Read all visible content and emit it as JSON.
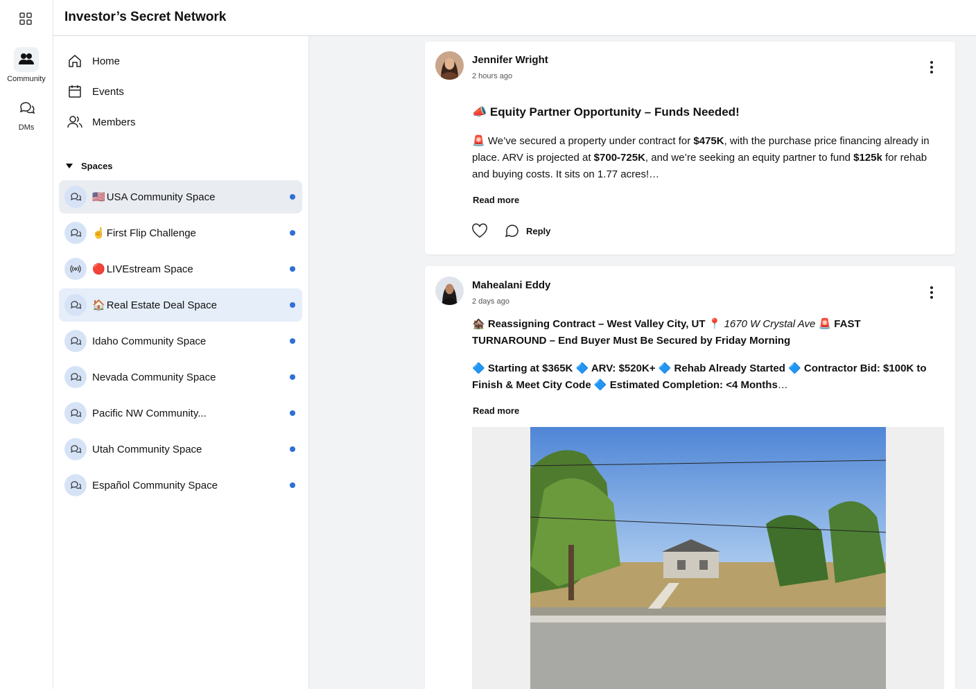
{
  "app": {
    "title": "Investor’s Secret Network"
  },
  "rail": {
    "items": [
      {
        "label": "Community",
        "icon": "community-icon"
      },
      {
        "label": "DMs",
        "icon": "dm-icon"
      }
    ]
  },
  "nav": {
    "items": [
      {
        "label": "Home",
        "icon": "home-icon"
      },
      {
        "label": "Events",
        "icon": "calendar-icon"
      },
      {
        "label": "Members",
        "icon": "members-icon"
      }
    ]
  },
  "spaces": {
    "heading": "Spaces",
    "items": [
      {
        "emoji": "🇺🇸",
        "label": "USA Community Space",
        "icon": "chat-icon",
        "unread": true
      },
      {
        "emoji": "☝️",
        "label": "First Flip Challenge",
        "icon": "chat-icon",
        "unread": true
      },
      {
        "emoji": "🔴",
        "label": "LIVEstream Space",
        "icon": "broadcast-icon",
        "unread": true
      },
      {
        "emoji": "🏠",
        "label": "Real Estate Deal Space",
        "icon": "chat-icon",
        "unread": true
      },
      {
        "emoji": "",
        "label": "Idaho Community Space",
        "icon": "chat-icon",
        "unread": true
      },
      {
        "emoji": "",
        "label": "Nevada Community Space",
        "icon": "chat-icon",
        "unread": true
      },
      {
        "emoji": "",
        "label": "Pacific NW Community...",
        "icon": "chat-icon",
        "unread": true
      },
      {
        "emoji": "",
        "label": "Utah Community Space",
        "icon": "chat-icon",
        "unread": true
      },
      {
        "emoji": "",
        "label": "Español Community Space",
        "icon": "chat-icon",
        "unread": true
      }
    ]
  },
  "posts": [
    {
      "author": "Jennifer Wright",
      "time": "2 hours ago",
      "title": "📣 Equity Partner Opportunity – Funds Needed!",
      "body": {
        "p1": "🚨 We’ve secured a property under contract for ",
        "b1": "$475K",
        "p2": ", with the purchase price financing already in place.  ARV is projected at ",
        "b2": "$700-725K",
        "p3": ", and we’re seeking an equity partner to fund ",
        "b3": "$125k",
        "p4": " for rehab and buying costs.  It sits on 1.77 acres!…"
      },
      "read_more": "Read more",
      "reply": "Reply"
    },
    {
      "author": "Mahealani Eddy",
      "time": "2 days ago",
      "line1_a": "🏚️ Reassigning Contract – West Valley City, UT 📍 ",
      "line1_i": "1670 W Crystal Ave",
      "line1_b": " 🚨 FAST TURNAROUND – End Buyer Must Be Secured by Friday Morning",
      "line2": "🔷 Starting at $365K 🔷 ARV: $520K+ 🔷 Rehab Already Started 🔷 Contractor Bid: $100K to Finish & Meet City Code 🔷 Estimated Completion: <4 Months",
      "line2_tail": "…",
      "read_more": "Read more"
    }
  ],
  "colors": {
    "accent": "#2f6fd6",
    "space_icon_bg": "#d6e3f7",
    "feed_bg": "#f2f3f5"
  }
}
